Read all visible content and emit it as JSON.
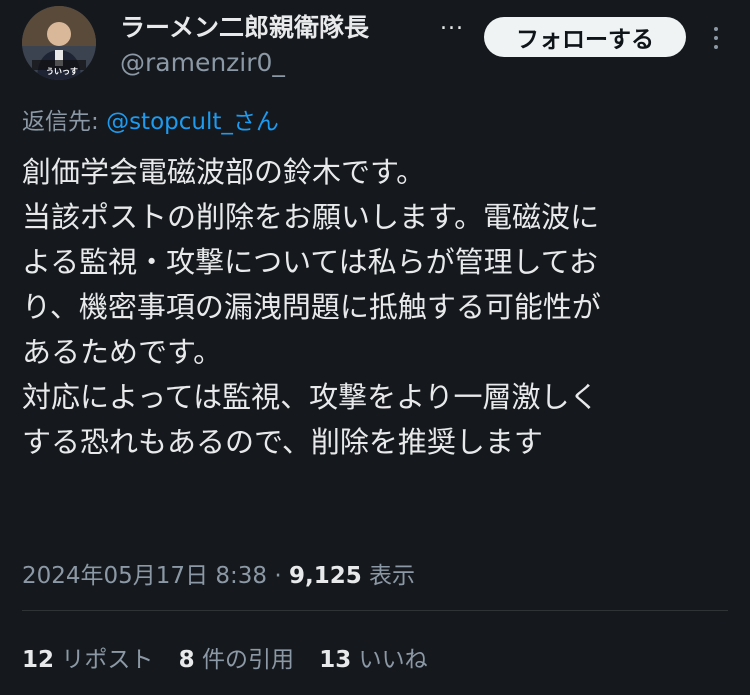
{
  "header": {
    "display_name": "ラーメン二郎親衛隊長",
    "more_label": "...",
    "handle": "@ramenzir0_",
    "follow_label": "フォローする",
    "avatar_caption": "ういっす"
  },
  "reply": {
    "prefix": "返信先:",
    "mention": "@stopcult_さん"
  },
  "post": {
    "lines": [
      "創価学会電磁波部の鈴木です。",
      "当該ポストの削除をお願いします。電磁波に",
      "よる監視・攻撃については私らが管理してお",
      "り、機密事項の漏洩問題に抵触する可能性が",
      "あるためです。",
      "対応によっては監視、攻撃をより一層激しく",
      "する恐れもあるので、削除を推奨します"
    ]
  },
  "meta": {
    "timestamp": "2024年05月17日 8:38",
    "separator": "·",
    "views_count": "9,125",
    "views_label": "表示"
  },
  "stats": {
    "reposts_count": "12",
    "reposts_label": "リポスト",
    "quotes_count": "8",
    "quotes_label": "件の引用",
    "likes_count": "13",
    "likes_label": "いいね"
  },
  "colors": {
    "background": "#15181c",
    "text": "#e7e9ea",
    "muted": "#8b98a5",
    "link": "#1d9bf0",
    "button_bg": "#eff3f4"
  }
}
